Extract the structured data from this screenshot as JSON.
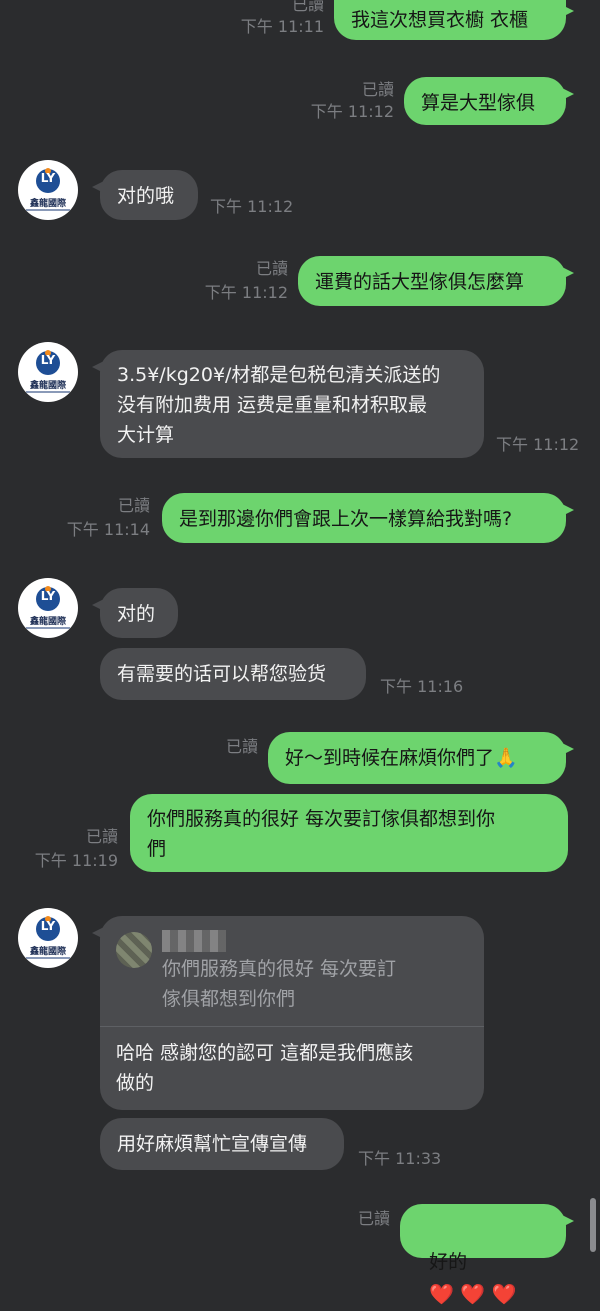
{
  "messages": {
    "m1": {
      "text": "我這次想買衣櫥 衣櫃",
      "read": "已讀",
      "time": "下午 11:11"
    },
    "m2": {
      "text": "算是大型傢俱",
      "read": "已讀",
      "time": "下午 11:12"
    },
    "m3": {
      "text": "对的哦",
      "time": "下午 11:12"
    },
    "m4": {
      "text": "運費的話大型傢俱怎麼算",
      "read": "已讀",
      "time": "下午 11:12"
    },
    "m5": {
      "text": "3.5¥/kg20¥/材都是包税包清关派送的\n没有附加费用 运费是重量和材积取最\n大计算",
      "time": "下午 11:12"
    },
    "m6": {
      "text": "是到那邊你們會跟上次一樣算給我對嗎?",
      "read": "已讀",
      "time": "下午 11:14"
    },
    "m7": {
      "text": "对的"
    },
    "m8": {
      "text": "有需要的话可以帮您验货",
      "time": "下午 11:16"
    },
    "m9": {
      "text": "好～到時候在麻煩你們了🙏",
      "read": "已讀"
    },
    "m10": {
      "text": "你們服務真的很好 每次要訂傢俱都想到你\n們",
      "read": "已讀",
      "time": "下午 11:19"
    },
    "m11": {
      "quoted": "你們服務真的很好 每次要訂\n傢俱都想到你們",
      "reply": "哈哈 感謝您的認可 這都是我們應該\n做的"
    },
    "m12": {
      "text": "用好麻煩幫忙宣傳宣傳",
      "time": "下午 11:33"
    },
    "m13": {
      "text": "好的",
      "hearts": "❤️ ❤️ ❤️",
      "read": "已讀"
    }
  },
  "avatar": {
    "letters": "LY",
    "name": "鑫龍國際"
  },
  "colors": {
    "outgoing": "#6dd46e",
    "incoming": "#4a4b4e",
    "background": "#2b2c2e",
    "meta": "#7c7e82"
  }
}
